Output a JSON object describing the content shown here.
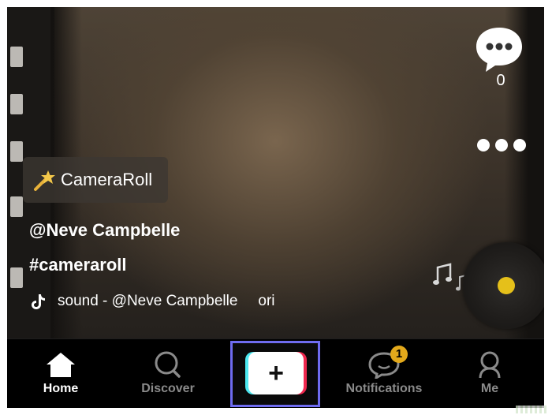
{
  "video": {
    "comment_count": "0",
    "effect_label": "CameraRoll",
    "username": "@Neve Campbelle",
    "hashtag": "#cameraroll",
    "sound_text": "sound - @Neve Campbelle",
    "sound_suffix": "ori"
  },
  "nav": {
    "home": "Home",
    "discover": "Discover",
    "create": "+",
    "notifications": "Notifications",
    "notifications_badge": "1",
    "me": "Me"
  },
  "colors": {
    "highlight_border": "#6f6cf0",
    "badge": "#e3a91b",
    "disc_center": "#e5c01a",
    "create_cyan": "#4de8f0",
    "create_red": "#f0284f"
  },
  "icons": [
    "comment-icon",
    "more-icon",
    "magic-wand-icon",
    "tiktok-note-icon",
    "music-notes-icon",
    "home-icon",
    "search-icon",
    "notifications-icon",
    "profile-icon"
  ]
}
